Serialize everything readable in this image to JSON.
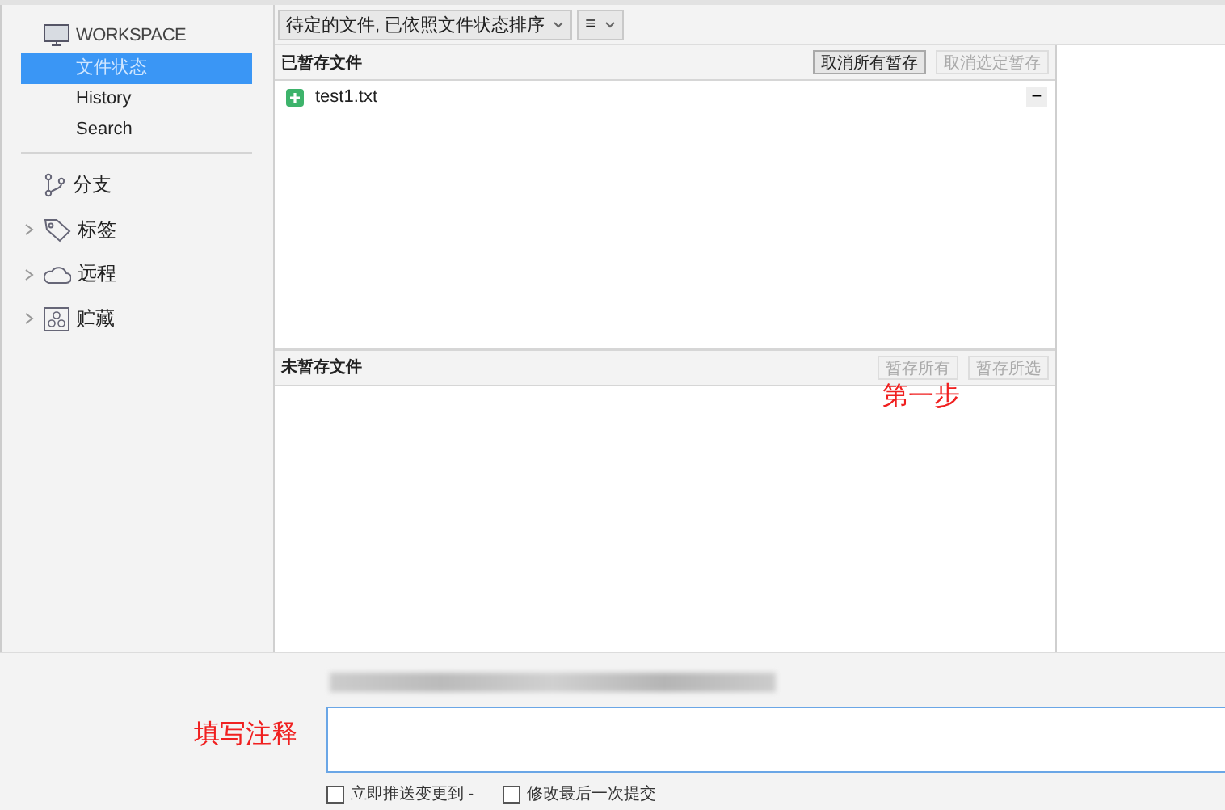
{
  "sidebar": {
    "workspace": {
      "title": "WORKSPACE",
      "items": [
        {
          "label": "文件状态",
          "selected": true
        },
        {
          "label": "History",
          "selected": false
        },
        {
          "label": "Search",
          "selected": false
        }
      ]
    },
    "sections": [
      {
        "kind": "branch",
        "label": "分支"
      },
      {
        "kind": "tag",
        "label": "标签",
        "expanded": false
      },
      {
        "kind": "remote",
        "label": "远程",
        "expanded": false
      },
      {
        "kind": "stash",
        "label": "贮藏",
        "expanded": false
      }
    ]
  },
  "toolbar": {
    "filter": "待定的文件, 已依照文件状态排序",
    "view_menu": "≡"
  },
  "staged": {
    "title": "已暂存文件",
    "buttons": [
      {
        "label": "取消所有暂存",
        "disabled": false
      },
      {
        "label": "取消选定暂存",
        "disabled": true
      }
    ],
    "files": [
      {
        "name": "test1.txt",
        "kind": "added"
      }
    ],
    "collapse": "−"
  },
  "unstaged": {
    "title": "未暂存文件",
    "buttons": [
      {
        "label": "暂存所有",
        "disabled": true
      },
      {
        "label": "暂存所选",
        "disabled": true
      }
    ]
  },
  "annotations": [
    {
      "text": "第一步"
    },
    {
      "text": "填写注释"
    }
  ],
  "commit": {
    "options": [
      {
        "label": "立即推送变更到 -",
        "checked": false
      },
      {
        "label": "修改最后一次提交",
        "checked": false
      }
    ]
  }
}
